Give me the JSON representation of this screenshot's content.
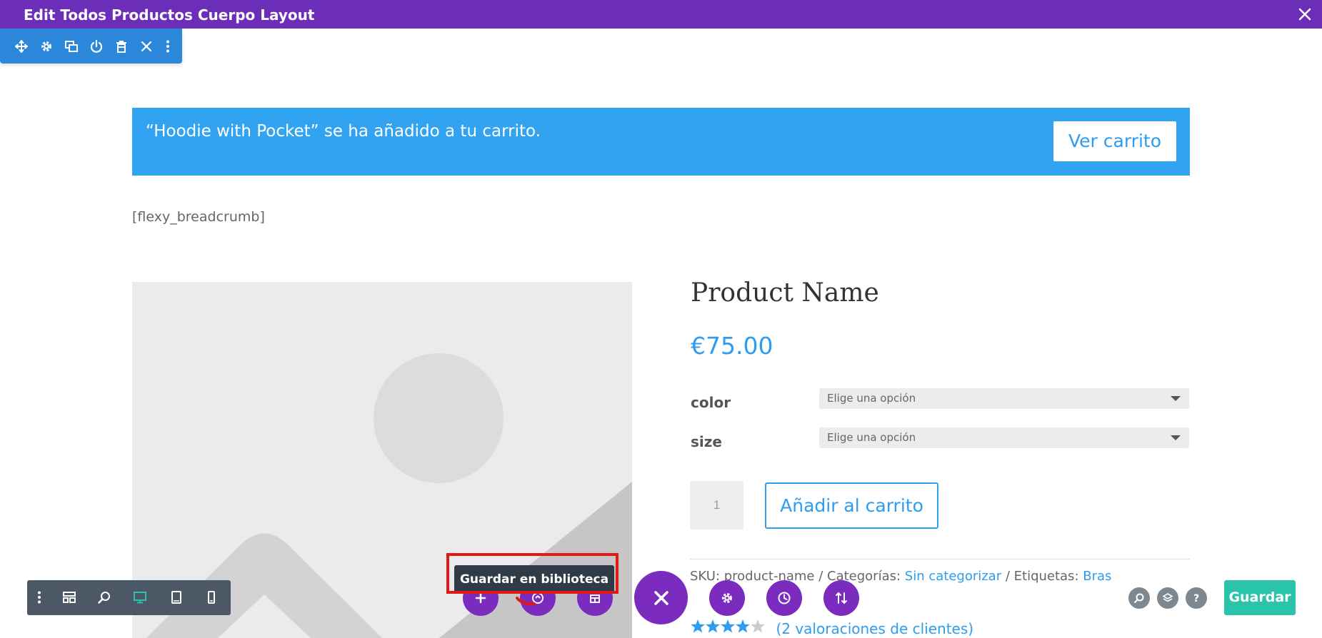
{
  "topbar": {
    "title": "Edit Todos Productos Cuerpo Layout",
    "bg_color": "#6c2eb9"
  },
  "row_toolbar": {
    "icons": [
      "move-icon",
      "gear-icon",
      "duplicate-icon",
      "power-icon",
      "trash-icon",
      "close-icon",
      "more-vertical-icon"
    ],
    "bg_color": "#2b87da"
  },
  "notice": {
    "message": "“Hoodie with Pocket” se ha añadido a tu carrito.",
    "button_label": "Ver carrito",
    "bg_color": "#32a3f1"
  },
  "breadcrumb_shortcode": "[flexy_breadcrumb]",
  "product": {
    "name": "Product Name",
    "price": "€75.00",
    "attributes": [
      {
        "label": "color",
        "placeholder": "Elige una opción"
      },
      {
        "label": "size",
        "placeholder": "Elige una opción"
      }
    ],
    "quantity": "1",
    "add_to_cart_label": "Añadir al carrito",
    "meta": {
      "sku_prefix": "SKU: ",
      "sku": "product-name",
      "sep1": " / Categorías: ",
      "category": "Sin categorizar",
      "sep2": " / Etiquetas: ",
      "tag": "Bras"
    },
    "rating_stars": 4,
    "rating_max": 5,
    "reviews_label": "(2 valoraciones de clientes)"
  },
  "view_toolbar": {
    "icons": [
      "more-vertical-icon",
      "wireframe-icon",
      "zoom-icon",
      "desktop-icon",
      "tablet-icon",
      "phone-icon"
    ],
    "active": "desktop-icon"
  },
  "builder_actions": {
    "icons": [
      "add-icon",
      "library-icon",
      "portability-icon",
      "close-icon",
      "gear-icon",
      "history-icon",
      "sort-icon"
    ],
    "tooltip": "Guardar en biblioteca"
  },
  "right_actions": {
    "icons": [
      "search-icon",
      "layers-icon",
      "help-icon"
    ],
    "save_label": "Guardar",
    "save_color": "#29c4a9"
  }
}
